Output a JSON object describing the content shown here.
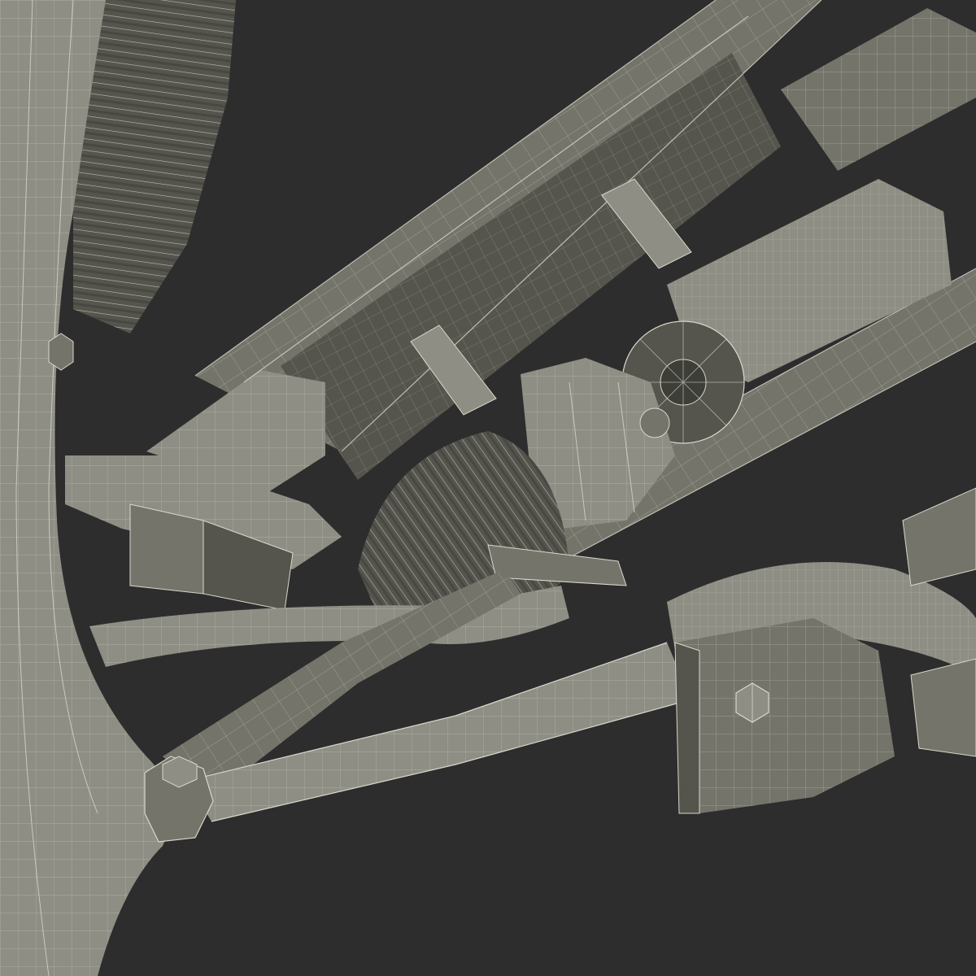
{
  "scene": {
    "subject": "wireframe-3d-model-suspension-assembly",
    "colors": {
      "background": "#2d2d2d",
      "surface_light": "#8e8e85",
      "surface_mid": "#74746b",
      "surface_dark": "#55554e",
      "surface_shadow": "#3e3e39",
      "wire": "#d8d8cc"
    }
  }
}
